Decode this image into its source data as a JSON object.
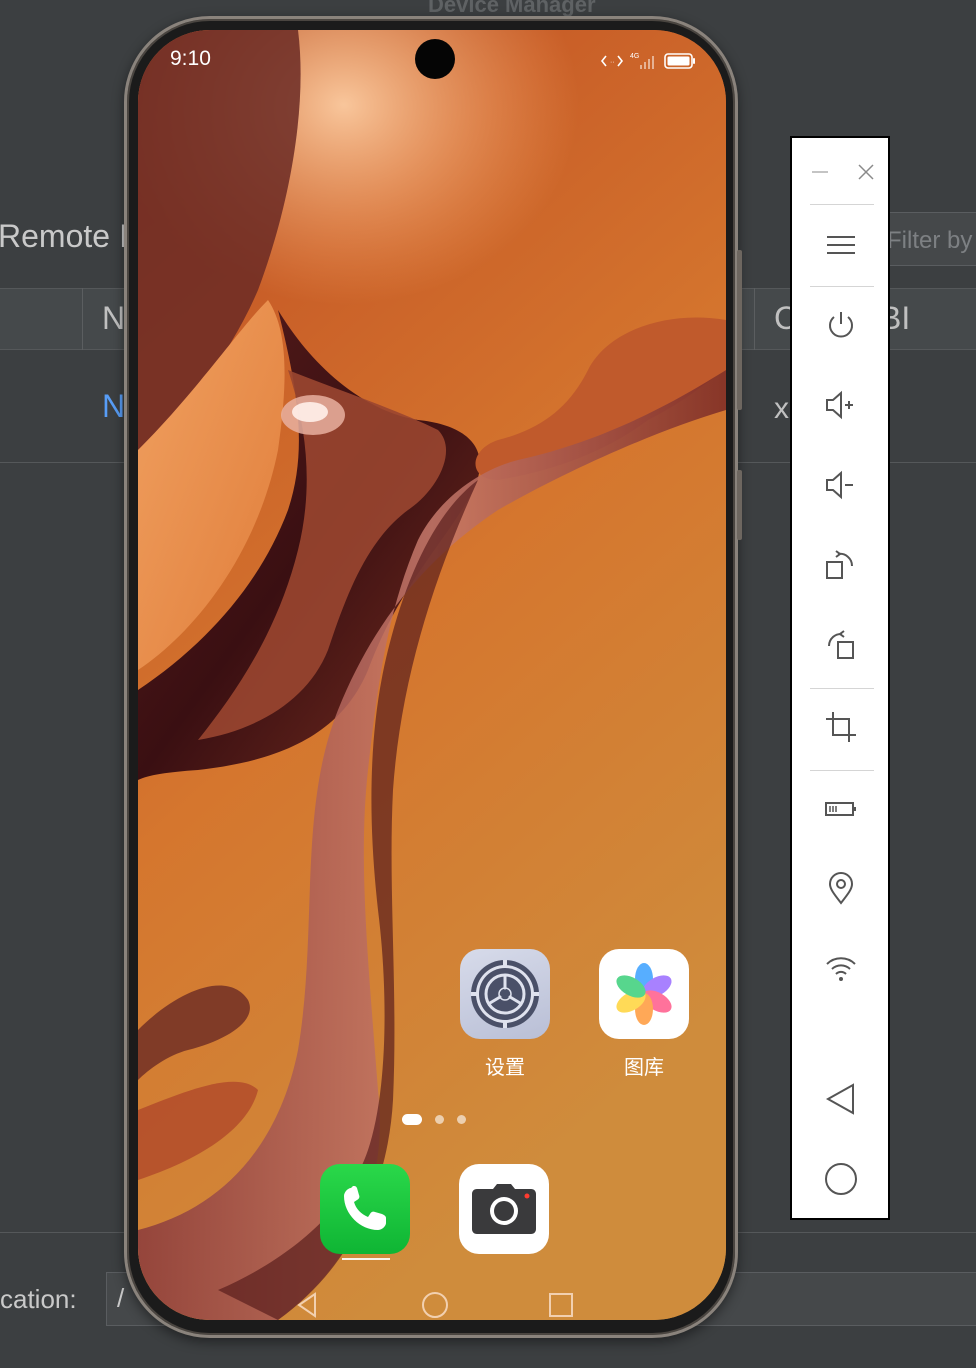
{
  "ide": {
    "window_title": "Device Manager",
    "section_title": "Remote I",
    "filter_placeholder": "Filter by",
    "table": {
      "columns": [
        "N",
        "C",
        "BI"
      ],
      "rows": [
        {
          "name": "N",
          "value": "x"
        }
      ]
    },
    "location_label": "cation:",
    "location_value": "/"
  },
  "phone": {
    "status_bar": {
      "time": "9:10",
      "network": "4G"
    },
    "home_apps": [
      {
        "label": "设置",
        "icon": "settings-gear-icon"
      },
      {
        "label": "图库",
        "icon": "gallery-flower-icon"
      }
    ],
    "page_indicator": {
      "pages": 3,
      "current": 1
    },
    "dock_apps": [
      {
        "label": "",
        "icon": "phone-icon",
        "color": "#1bc83c"
      },
      {
        "label": "",
        "icon": "camera-icon"
      }
    ],
    "nav_buttons": [
      "back",
      "home",
      "recents"
    ]
  },
  "toolbar": {
    "window_controls": [
      "minimize",
      "close"
    ],
    "buttons": [
      "menu-icon",
      "power-icon",
      "volume-up-icon",
      "volume-down-icon",
      "rotate-clockwise-icon",
      "rotate-counterclockwise-icon",
      "screenshot-crop-icon",
      "battery-icon",
      "location-pin-icon",
      "wifi-icon",
      "back-triangle-icon",
      "home-circle-icon"
    ]
  },
  "colors": {
    "ide_background": "#3c3f41",
    "link_blue": "#589df6",
    "wallpaper_orange": "#d17530",
    "phone_green": "#1bc83c"
  }
}
